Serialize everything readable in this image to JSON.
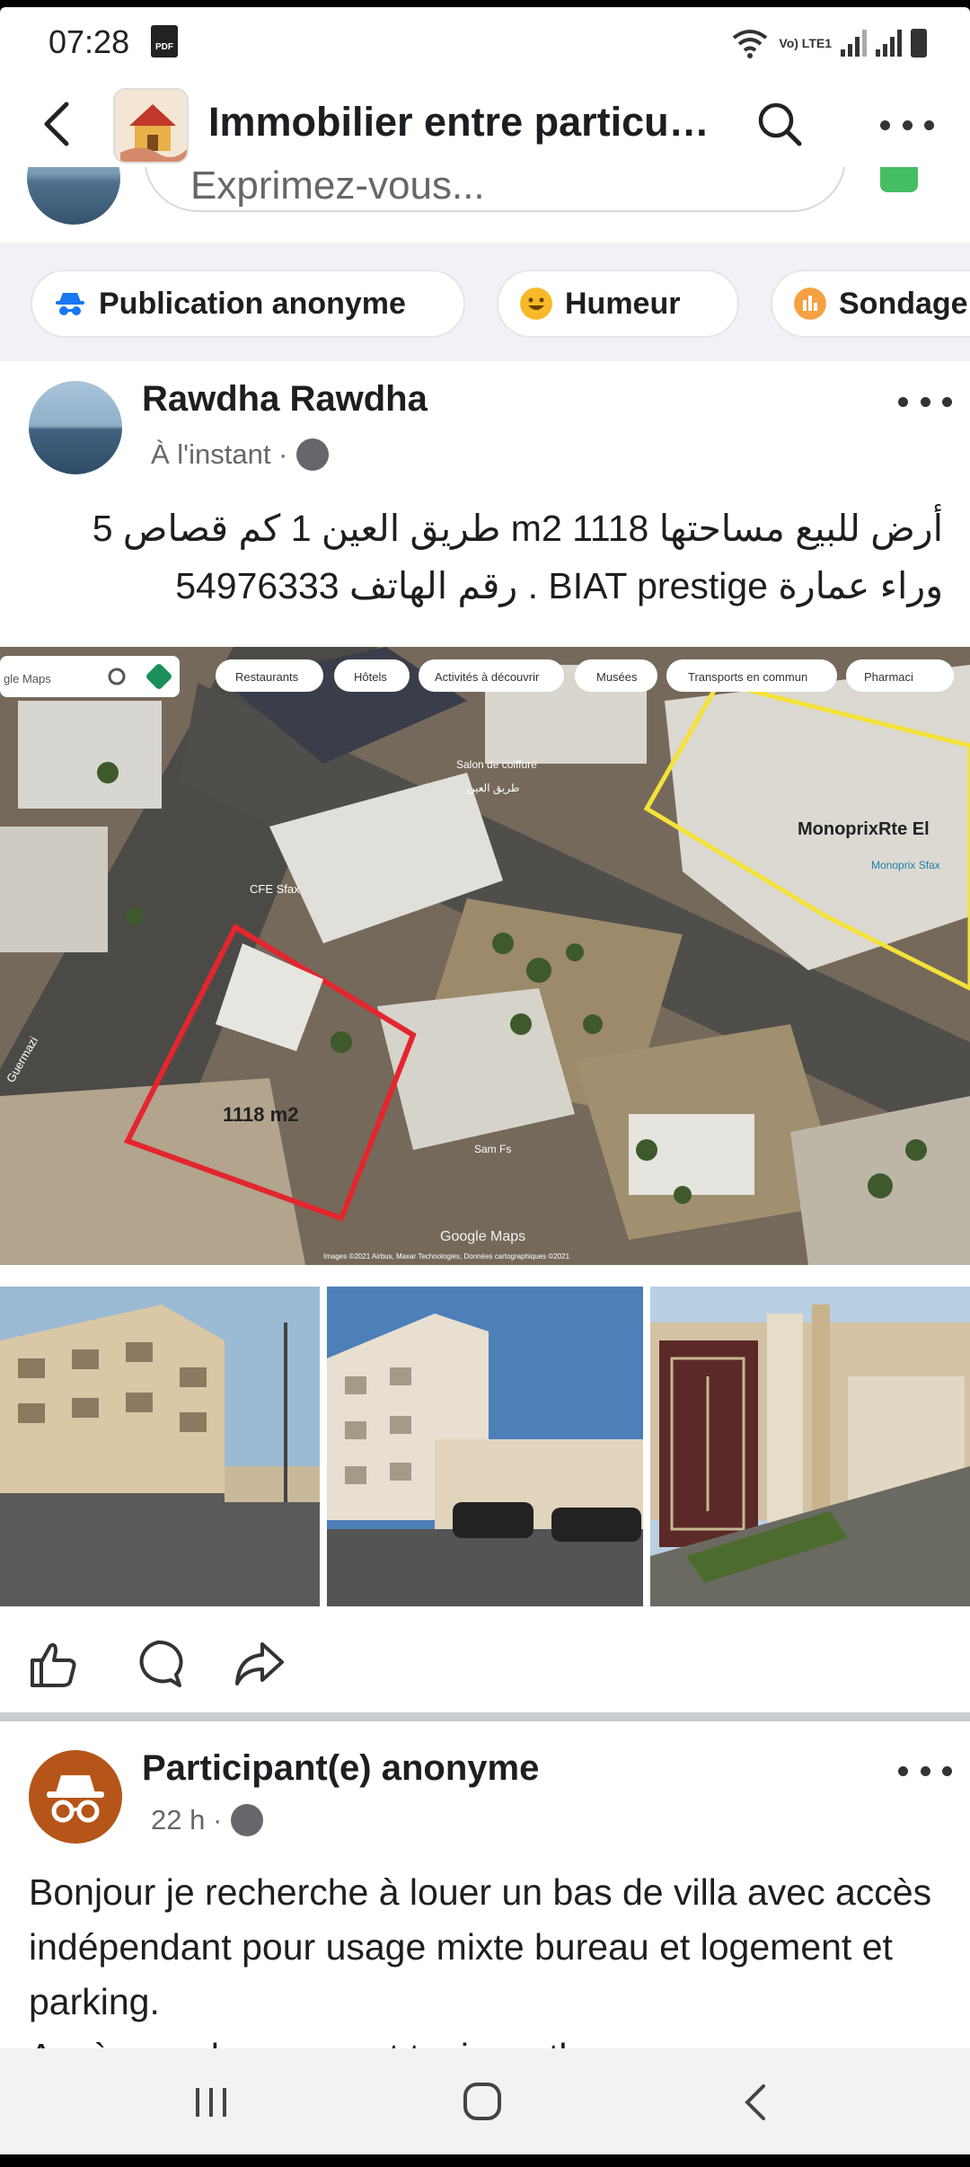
{
  "status_bar": {
    "time": "07:28",
    "pdf_icon": "pdf-icon",
    "network": "Vo) LTE1",
    "icons": [
      "wifi-icon",
      "signal-icon",
      "battery-icon"
    ]
  },
  "header": {
    "title": "Immobilier entre particu…",
    "back_icon": "back-arrow-icon",
    "search_icon": "search-icon",
    "more_icon": "more-icon"
  },
  "composer": {
    "placeholder": "Exprimez-vous..."
  },
  "chips": [
    {
      "label": "Publication anonyme",
      "icon": "anonymous-icon",
      "color": "#1877f2"
    },
    {
      "label": "Humeur",
      "icon": "smiley-icon",
      "color": "#f7b928"
    },
    {
      "label": "Sondage",
      "icon": "poll-icon",
      "color": "#f5a142"
    }
  ],
  "post1": {
    "author": "Rawdha Rawdha",
    "time": "À l'instant ·",
    "text_line1": "أرض للبيع  مساحتها 1118 m2 طريق العين 1 كم قصاص 5",
    "text_line2": "وراء عمارة BIAT  prestige . رقم الهاتف 54976333",
    "map": {
      "search_text": "gle Maps",
      "filters": [
        "Restaurants",
        "Hôtels",
        "Activités à découvrir",
        "Musées",
        "Transports en commun",
        "Pharmaci"
      ],
      "plot_label": "1118 m2",
      "place_label": "MonoprixRte El",
      "place_small": "Monoprix Sfax",
      "shop_label": "CFE Sfax",
      "street_label": "Guermazi",
      "salon_label": "Salon de coiffure",
      "road_label": "طريق العين",
      "sam_label": "Sam Fs",
      "watermark": "Google Maps",
      "credits": "Images ©2021 Airbus, Maxar Technologies, Données cartographiques ©2021"
    }
  },
  "post2": {
    "author": "Participant(e) anonyme",
    "time": "22 h ·",
    "text": "Bonjour je recherche à louer un bas de villa avec accès indépendant pour usage mixte bureau et logement et parking.",
    "text_cut": "Accès proche aeroport tunis carthage max"
  },
  "actions": [
    "like-icon",
    "comment-icon",
    "share-icon"
  ],
  "nav": [
    "recents-icon",
    "home-icon",
    "back-icon"
  ],
  "colors": {
    "brand_blue": "#1877f2",
    "plot_outline": "#e3262e",
    "monoprix_outline": "#f4e23a",
    "anon_avatar": "#b55519"
  }
}
